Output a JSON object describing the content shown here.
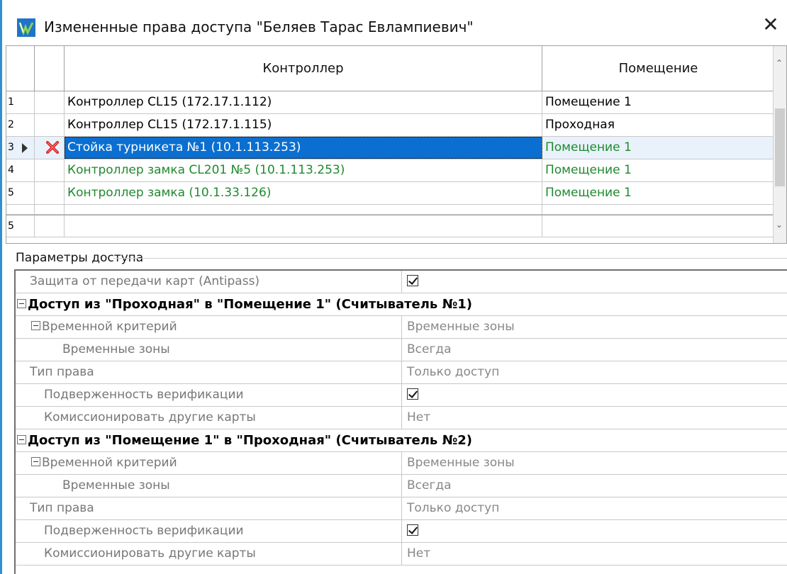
{
  "window": {
    "title": "Измененные права доступа \"Беляев Тарас Евлампиевич\"",
    "close_glyph": "✕"
  },
  "grid": {
    "columns": [
      "",
      "",
      "Контроллер",
      "Помещение"
    ],
    "rows": [
      {
        "num": "1",
        "controller": "Контроллер CL15 (172.17.1.112)",
        "room": "Помещение 1",
        "state": "normal"
      },
      {
        "num": "2",
        "controller": "Контроллер CL15 (172.17.1.115)",
        "room": "Проходная",
        "state": "normal"
      },
      {
        "num": "3",
        "controller": "Стойка турникета №1 (10.1.113.253)",
        "room": "Помещение 1",
        "state": "selected-deleted"
      },
      {
        "num": "4",
        "controller": "Контроллер замка CL201 №5 (10.1.113.253)",
        "room": "Помещение 1",
        "state": "added"
      },
      {
        "num": "5",
        "controller": "Контроллер замка (10.1.33.126)",
        "room": "Помещение 1",
        "state": "added"
      }
    ],
    "footer_count": "5"
  },
  "params": {
    "label": "Параметры доступа",
    "antipass_label": "Защита от передачи карт (Antipass)",
    "antipass_checked": true,
    "sections": [
      {
        "title": "Доступ из \"Проходная\" в \"Помещение 1\" (Считыватель №1)",
        "time_criterion_label": "Временной критерий",
        "time_criterion_value": "Временные зоны",
        "time_zones_label": "Временные зоны",
        "time_zones_value": "Всегда",
        "right_type_label": "Тип права",
        "right_type_value": "Только доступ",
        "verification_label": "Подверженность верификации",
        "verification_checked": true,
        "commission_label": "Комиссионировать другие карты",
        "commission_value": "Нет"
      },
      {
        "title": "Доступ из \"Помещение 1\" в \"Проходная\" (Считыватель №2)",
        "time_criterion_label": "Временной критерий",
        "time_criterion_value": "Временные зоны",
        "time_zones_label": "Временные зоны",
        "time_zones_value": "Всегда",
        "right_type_label": "Тип права",
        "right_type_value": "Только доступ",
        "verification_label": "Подверженность верификации",
        "verification_checked": true,
        "commission_label": "Комиссионировать другие карты",
        "commission_value": "Нет"
      }
    ]
  },
  "colors": {
    "accent": "#2e8fd6",
    "selection": "#0a6fd0",
    "added_text": "#1e8a2e",
    "deleted_mark": "#d42020"
  },
  "icons": {
    "app": "app-logo-icon",
    "close": "close-icon",
    "deleted": "red-x-icon",
    "current_row": "row-pointer-icon",
    "collapse": "minus-box-icon"
  }
}
